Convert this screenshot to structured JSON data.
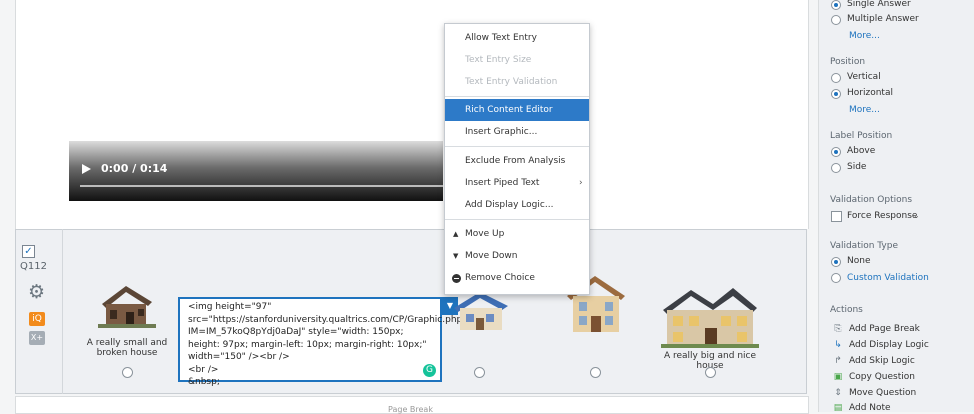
{
  "video": {
    "time": "0:00 / 0:14"
  },
  "question": {
    "id": "Q112"
  },
  "choices": [
    {
      "label": "A really small and broken house"
    },
    {
      "label": ""
    },
    {
      "label": ""
    },
    {
      "label": ""
    },
    {
      "label": "A really big and nice house"
    }
  ],
  "editor": {
    "content": "<img height=\"97\"\nsrc=\"https://stanforduniversity.qualtrics.com/CP/Graphic.php?IM=IM_57koQ8pYdj0aDaJ\" style=\"width: 150px; height: 97px; margin-left: 10px; margin-right: 10px;\" width=\"150\" /><br />\n<br />\n&nbsp;"
  },
  "page_break": {
    "label": "Page Break"
  },
  "context_menu": {
    "items": [
      {
        "label": "Allow Text Entry"
      },
      {
        "label": "Text Entry Size"
      },
      {
        "label": "Text Entry Validation"
      },
      {
        "label": "Rich Content Editor"
      },
      {
        "label": "Insert Graphic..."
      },
      {
        "label": "Exclude From Analysis"
      },
      {
        "label": "Insert Piped Text"
      },
      {
        "label": "Add Display Logic..."
      },
      {
        "label": "Move Up"
      },
      {
        "label": "Move Down"
      },
      {
        "label": "Remove Choice"
      }
    ]
  },
  "panel": {
    "answers": {
      "single": "Single Answer",
      "multiple": "Multiple Answer",
      "more": "More..."
    },
    "position": {
      "title": "Position",
      "vertical": "Vertical",
      "horizontal": "Horizontal",
      "more": "More..."
    },
    "label_position": {
      "title": "Label Position",
      "above": "Above",
      "side": "Side"
    },
    "validation_options": {
      "title": "Validation Options",
      "force": "Force Response"
    },
    "validation_type": {
      "title": "Validation Type",
      "none": "None",
      "custom": "Custom Validation"
    },
    "actions": {
      "title": "Actions",
      "items": [
        {
          "label": "Add Page Break"
        },
        {
          "label": "Add Display Logic"
        },
        {
          "label": "Add Skip Logic"
        },
        {
          "label": "Copy Question"
        },
        {
          "label": "Move Question"
        },
        {
          "label": "Add Note"
        }
      ]
    }
  },
  "colors": {
    "accent": "#1e73be",
    "menu_active": "#2d7ac8"
  }
}
